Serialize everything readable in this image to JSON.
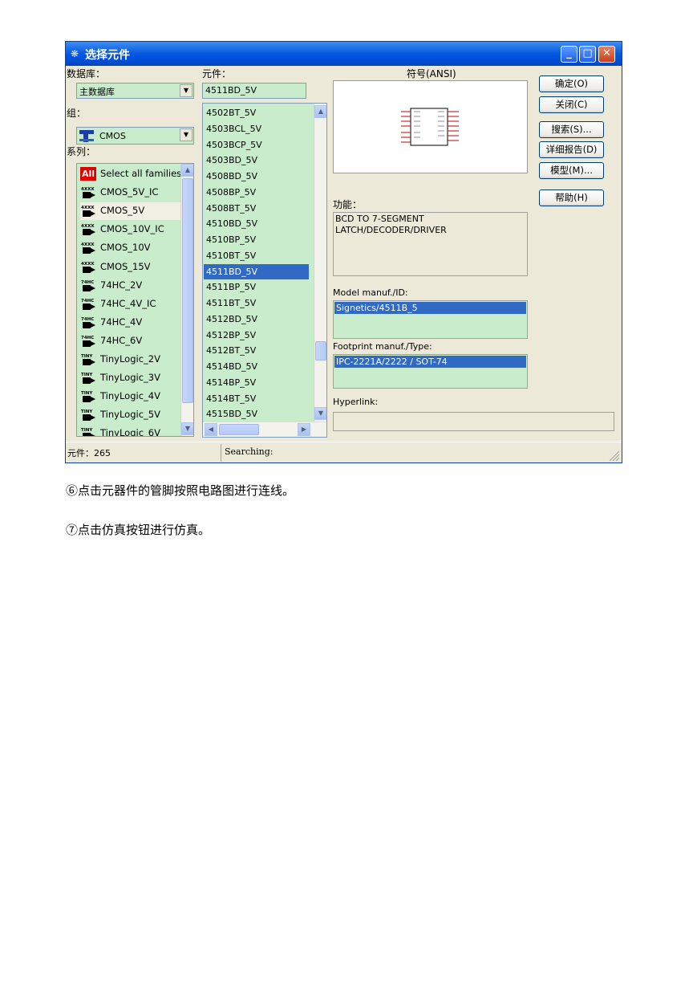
{
  "window": {
    "title": "选择元件",
    "title_icon": "component-icon",
    "controls": [
      "minimize",
      "maximize",
      "close"
    ]
  },
  "database": {
    "label": "数据库：",
    "value": "主数据库"
  },
  "group": {
    "label": "组：",
    "value": "CMOS",
    "icon_text": "CMOS-icon"
  },
  "family": {
    "label": "系列：",
    "items": [
      {
        "icon": "All",
        "label": "Select all families"
      },
      {
        "icon": "4XXX",
        "label": "CMOS_5V_IC"
      },
      {
        "icon": "4XXX",
        "label": "CMOS_5V"
      },
      {
        "icon": "4XXX",
        "label": "CMOS_10V_IC"
      },
      {
        "icon": "4XXX",
        "label": "CMOS_10V"
      },
      {
        "icon": "4XXX",
        "label": "CMOS_15V"
      },
      {
        "icon": "74HC",
        "label": "74HC_2V"
      },
      {
        "icon": "74HC",
        "label": "74HC_4V_IC"
      },
      {
        "icon": "74HC",
        "label": "74HC_4V"
      },
      {
        "icon": "74HC",
        "label": "74HC_6V"
      },
      {
        "icon": "TINY",
        "label": "TinyLogic_2V"
      },
      {
        "icon": "TINY",
        "label": "TinyLogic_3V"
      },
      {
        "icon": "TINY",
        "label": "TinyLogic_4V"
      },
      {
        "icon": "TINY",
        "label": "TinyLogic_5V"
      },
      {
        "icon": "TINY",
        "label": "TinyLogic_6V"
      }
    ],
    "selected_index": 2
  },
  "component": {
    "label": "元件：",
    "value": "4511BD_5V",
    "items": [
      "4502BT_5V",
      "4503BCL_5V",
      "4503BCP_5V",
      "4503BD_5V",
      "4508BD_5V",
      "4508BP_5V",
      "4508BT_5V",
      "4510BD_5V",
      "4510BP_5V",
      "4510BT_5V",
      "4511BD_5V",
      "4511BP_5V",
      "4511BT_5V",
      "4512BD_5V",
      "4512BP_5V",
      "4512BT_5V",
      "4514BD_5V",
      "4514BP_5V",
      "4514BT_5V",
      "4515BD_5V"
    ],
    "selected_index": 10
  },
  "symbol": {
    "label": "符号(ANSI)"
  },
  "function": {
    "label": "功能：",
    "text": "BCD TO 7-SEGMENT\nLATCH/DECODER/DRIVER"
  },
  "model": {
    "label": "Model manuf./ID:",
    "value": "Signetics/4511B_5"
  },
  "footprint": {
    "label": "Footprint manuf./Type:",
    "value": "IPC-2221A/2222 / SOT-74"
  },
  "hyperlink": {
    "label": "Hyperlink:",
    "value": ""
  },
  "buttons": {
    "ok": "确定(O)",
    "close": "关闭(C)",
    "search": "搜索(S)...",
    "detail": "详细报告(D)",
    "model": "模型(M)...",
    "help": "帮助(H)"
  },
  "status": {
    "count": "元件：265",
    "searching": "Searching:"
  },
  "doc": {
    "line1": "⑥点击元器件的管脚按照电路图进行连线。",
    "line2": "⑦点击仿真按钮进行仿真。"
  },
  "colors": {
    "list_bg": "#c9eccc",
    "selection": "#316ac5",
    "title_bar": "#0054e3"
  }
}
